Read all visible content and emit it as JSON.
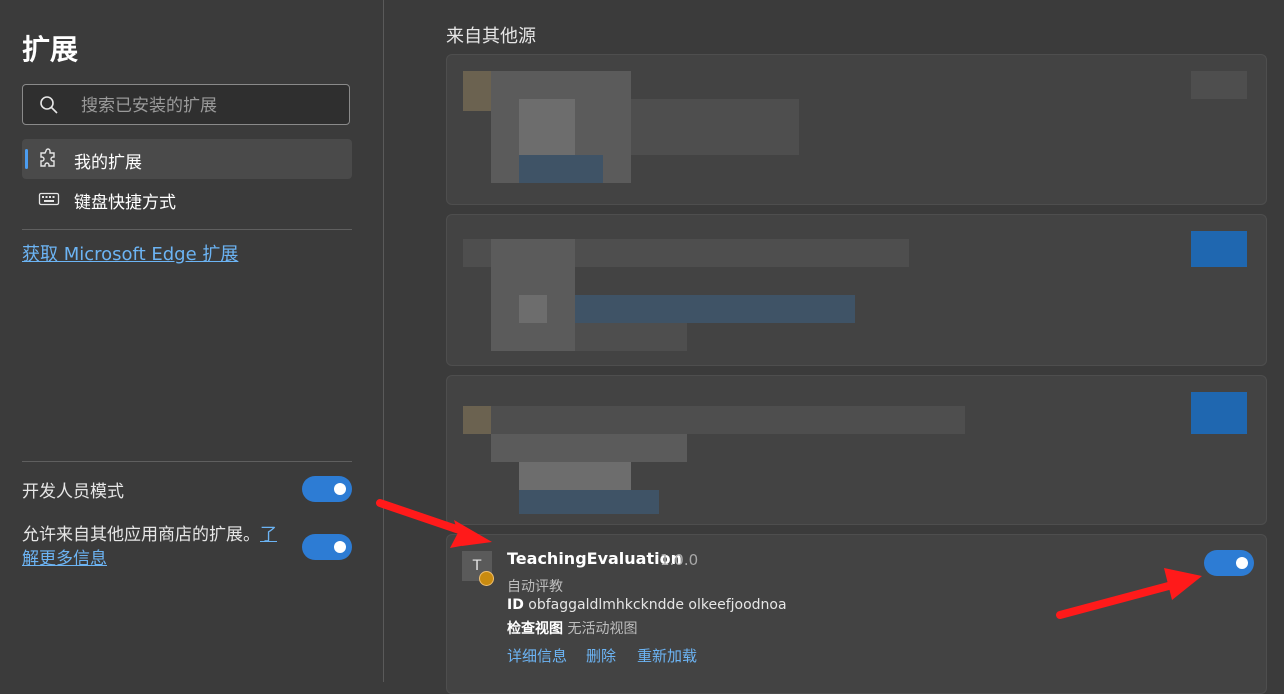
{
  "sidebar": {
    "title": "扩展",
    "search_placeholder": "搜索已安装的扩展",
    "nav": [
      {
        "label": "我的扩展",
        "icon": "puzzle-icon",
        "active": true
      },
      {
        "label": "键盘快捷方式",
        "icon": "keyboard-icon",
        "active": false
      }
    ],
    "get_extensions_link": "获取 Microsoft Edge 扩展",
    "developer_mode_label": "开发人员模式",
    "developer_mode_on": true,
    "allow_other_stores_text": "允许来自其他应用商店的扩展。",
    "learn_more_link_part1": "了",
    "learn_more_link_part2": "解更多信息",
    "allow_other_stores_on": true
  },
  "main": {
    "section_title": "来自其他源",
    "featured_extension": {
      "name": "TeachingEvaluation",
      "version": "1.0.0",
      "description": "自动评教",
      "id_label": "ID",
      "id_value": "obfaggaldlmhkckndde olkeefjoodnoa",
      "inspect_label": "检查视图",
      "inspect_value": "无活动视图",
      "actions": [
        "详细信息",
        "删除",
        "重新加载"
      ],
      "enabled": true,
      "icon_letter": "T"
    }
  },
  "colors": {
    "accent": "#2d7cd4",
    "link": "#6cb4f4",
    "background": "#3b3b3b",
    "card": "#434343",
    "annotation_arrow": "#ff1a1a"
  }
}
